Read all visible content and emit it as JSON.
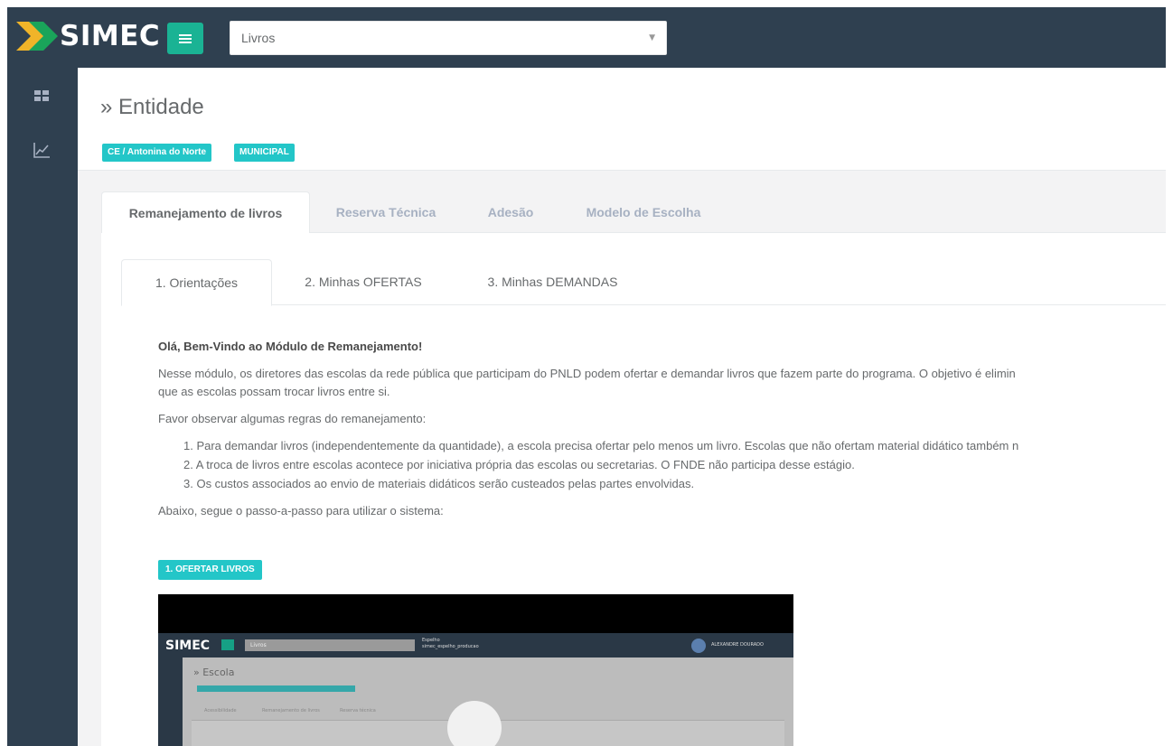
{
  "app": {
    "name": "SIMEC"
  },
  "header": {
    "select_value": "Livros"
  },
  "sidebar": {
    "items": [
      {
        "icon": "grid-icon"
      },
      {
        "icon": "chart-line-icon"
      }
    ]
  },
  "page": {
    "title": "» Entidade",
    "badges": [
      "CE / Antonina do Norte",
      "MUNICIPAL"
    ]
  },
  "tabs": [
    {
      "label": "Remanejamento de livros",
      "active": true
    },
    {
      "label": "Reserva Técnica",
      "active": false
    },
    {
      "label": "Adesão",
      "active": false
    },
    {
      "label": "Modelo de Escolha",
      "active": false
    }
  ],
  "inner_tabs": [
    {
      "label": "1. Orientações",
      "active": true
    },
    {
      "label": "2. Minhas OFERTAS",
      "active": false
    },
    {
      "label": "3. Minhas DEMANDAS",
      "active": false
    }
  ],
  "content": {
    "welcome": "Olá, Bem-Vindo ao Módulo de Remanejamento!",
    "intro_line1": "Nesse módulo, os diretores das escolas da rede pública que participam do PNLD podem ofertar e demandar livros que fazem parte do programa. O objetivo é elimin",
    "intro_line2": "que as escolas possam trocar livros entre si.",
    "rules_heading": "Favor observar algumas regras do remanejamento:",
    "rules": [
      "1. Para demandar livros (independentemente da quantidade), a escola precisa ofertar pelo menos um livro. Escolas que não ofertam material didático também n",
      "2. A troca de livros entre escolas acontece por iniciativa própria das escolas ou secretarias. O FNDE não participa desse estágio.",
      "3. Os custos associados ao envio de materiais didáticos serão custeados pelas partes envolvidas."
    ],
    "steps_heading": "Abaixo, segue o passo-a-passo para utilizar o sistema:",
    "step_button": "1. OFERTAR LIVROS"
  },
  "video": {
    "logo": "SIMEC",
    "select": "Livros",
    "info_line1": "Espelho",
    "info_line2": "simec_espelho_producao",
    "user": "ALEXANDRE DOURADO",
    "title": "» Escola",
    "tabs": [
      "Acessibilidade",
      "Remanejamento de livros",
      "Reserva técnica"
    ]
  },
  "colors": {
    "dark": "#2f4050",
    "green": "#1ab394",
    "cyan": "#23c6c8"
  }
}
